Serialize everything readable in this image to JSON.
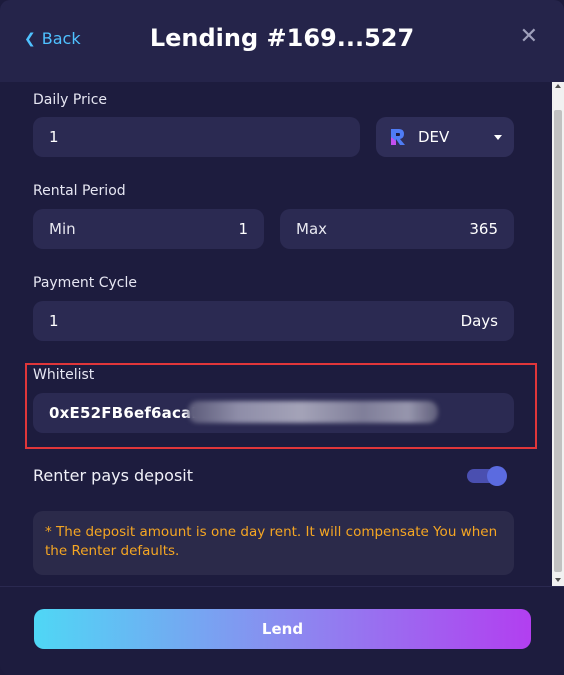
{
  "header": {
    "back_label": "Back",
    "title": "Lending #169...527"
  },
  "daily_price": {
    "label": "Daily Price",
    "value": "1",
    "currency": "DEV"
  },
  "rental_period": {
    "label": "Rental Period",
    "min_label": "Min",
    "min_value": "1",
    "max_label": "Max",
    "max_value": "365"
  },
  "payment_cycle": {
    "label": "Payment Cycle",
    "value": "1",
    "unit": "Days"
  },
  "whitelist": {
    "label": "Whitelist",
    "value": "0xE52FB6ef6acaL"
  },
  "deposit": {
    "label": "Renter pays deposit",
    "enabled": true,
    "notice": "* The deposit amount is one day rent. It will compensate You when the Renter defaults."
  },
  "footer": {
    "lend_label": "Lend"
  },
  "colors": {
    "accent_blue": "#4fc1ff",
    "warning": "#f5a623",
    "highlight_border": "#e0363a"
  }
}
